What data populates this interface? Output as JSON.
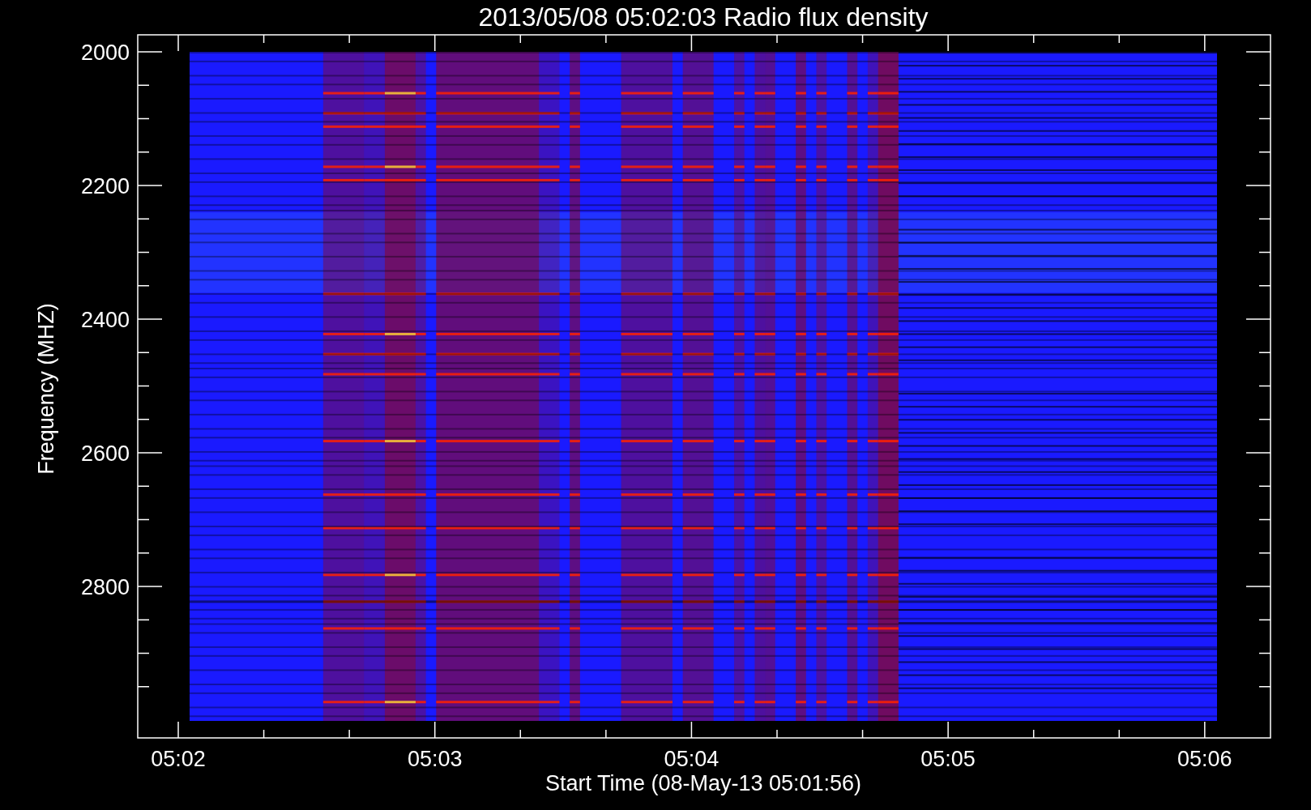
{
  "plot": {
    "title": "2013/05/08 05:02:03 Radio flux density",
    "ylabel": "Frequency (MHZ)",
    "xlabel": "Start Time (08-May-13 05:01:56)",
    "yticks": [
      "2000",
      "2200",
      "2400",
      "2600",
      "2800"
    ],
    "xticks": [
      "05:02",
      "05:03",
      "05:04",
      "05:05",
      "05:06"
    ]
  }
}
